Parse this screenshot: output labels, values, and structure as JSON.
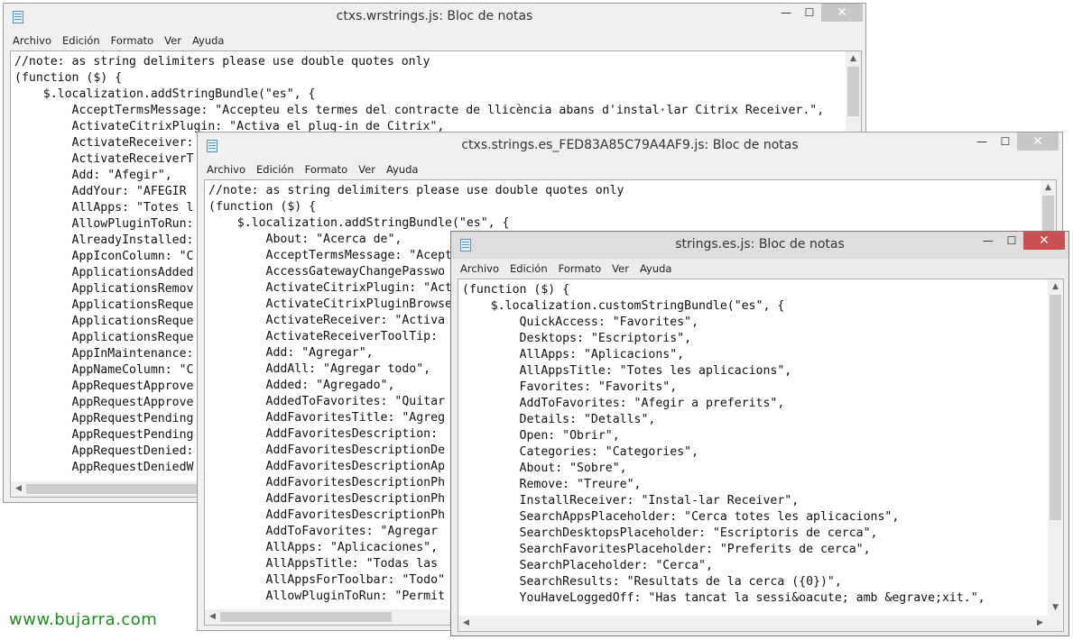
{
  "windows": {
    "w1": {
      "title": "ctxs.wrstrings.js: Bloc de notas",
      "lines": [
        "//note: as string delimiters please use double quotes only",
        "(function ($) {",
        "    $.localization.addStringBundle(\"es\", {",
        "        AcceptTermsMessage: \"Accepteu els termes del contracte de llicència abans d'instal·lar Citrix Receiver.\",",
        "        ActivateCitrixPlugin: \"Activa el plug-in de Citrix\",",
        "        ActivateReceiver:",
        "        ActivateReceiverT",
        "        Add: \"Afegir\",",
        "        AddYour: \"AFEGIR",
        "        AllApps: \"Totes l",
        "        AllowPluginToRun:",
        "        AlreadyInstalled:",
        "        AppIconColumn: \"C",
        "        ApplicationsAdded",
        "        ApplicationsRemov",
        "        ApplicationsReque",
        "        ApplicationsReque",
        "        ApplicationsReque",
        "        AppInMaintenance:",
        "        AppNameColumn: \"C",
        "        AppRequestApprove",
        "        AppRequestApprove",
        "        AppRequestPending",
        "        AppRequestPending",
        "        AppRequestDenied:",
        "        AppRequestDeniedW"
      ]
    },
    "w2": {
      "title": "ctxs.strings.es_FED83A85C79A4AF9.js: Bloc de notas",
      "lines": [
        "//note: as string delimiters please use double quotes only",
        "(function ($) {",
        "    $.localization.addStringBundle(\"es\", {",
        "        About: \"Acerca de\",",
        "        AcceptTermsMessage: \"Acept",
        "        AccessGatewayChangePasswo",
        "        ActivateCitrixPlugin: \"Act",
        "        ActivateCitrixPluginBrowse",
        "        ActivateReceiver: \"Activa",
        "        ActivateReceiverToolTip: ",
        "        Add: \"Agregar\",",
        "        AddAll: \"Agregar todo\",",
        "        Added: \"Agregado\",",
        "        AddedToFavorites: \"Quitar",
        "        AddFavoritesTitle: \"Agreg",
        "        AddFavoritesDescription: ",
        "        AddFavoritesDescriptionDe",
        "        AddFavoritesDescriptionAp",
        "        AddFavoritesDescriptionPh",
        "        AddFavoritesDescriptionPh",
        "        AddFavoritesDescriptionPh",
        "        AddToFavorites: \"Agregar ",
        "        AllApps: \"Aplicaciones\",",
        "        AllAppsTitle: \"Todas las ",
        "        AllAppsForToolbar: \"Todo\"",
        "        AllowPluginToRun: \"Permit"
      ]
    },
    "w3": {
      "title": "strings.es.js: Bloc de notas",
      "lines": [
        "(function ($) {",
        "    $.localization.customStringBundle(\"es\", {",
        "        QuickAccess: \"Favorites\",",
        "        Desktops: \"Escriptoris\",",
        "        AllApps: \"Aplicacions\",",
        "        AllAppsTitle: \"Totes les aplicacions\",",
        "        Favorites: \"Favorits\",",
        "        AddToFavorites: \"Afegir a preferits\",",
        "        Details: \"Detalls\",",
        "        Open: \"Obrir\",",
        "        Categories: \"Categories\",",
        "        About: \"Sobre\",",
        "        Remove: \"Treure\",",
        "        InstallReceiver: \"Instal-lar Receiver\",",
        "        SearchAppsPlaceholder: \"Cerca totes les aplicacions\",",
        "        SearchDesktopsPlaceholder: \"Escriptoris de cerca\",",
        "        SearchFavoritesPlaceholder: \"Preferits de cerca\",",
        "        SearchPlaceholder: \"Cerca\",",
        "        SearchResults: \"Resultats de la cerca ({0})\",",
        "        YouHaveLoggedOff: \"Has tancat la sessi&oacute; amb &egrave;xit.\","
      ]
    }
  },
  "menu": {
    "archivo": "Archivo",
    "edicion": "Edición",
    "formato": "Formato",
    "ver": "Ver",
    "ayuda": "Ayuda"
  },
  "controls": {
    "minimize": "—",
    "maximize": "☐",
    "close": "✕"
  },
  "watermark": "www.bujarra.com",
  "colors": {
    "close_active": "#c75050",
    "close_inactive": "#c7c7c7",
    "watermark": "#1f8a1f"
  }
}
